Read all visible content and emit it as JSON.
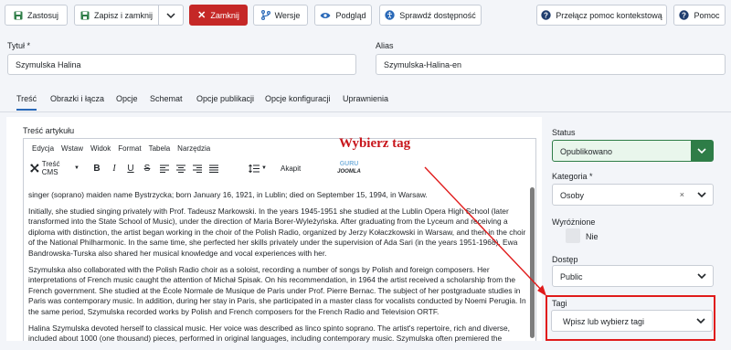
{
  "toolbar": {
    "apply": "Zastosuj",
    "save_close": "Zapisz i zamknij",
    "close": "Zamknij",
    "versions": "Wersje",
    "preview": "Podgląd",
    "accessibility": "Sprawdź dostępność",
    "toggle_help": "Przełącz pomoc kontekstową",
    "help": "Pomoc"
  },
  "form": {
    "title_label": "Tytuł *",
    "title_value": "Szymulska Halina",
    "alias_label": "Alias",
    "alias_value": "Szymulska-Halina-en"
  },
  "tabs": [
    "Treść",
    "Obrazki i łącza",
    "Opcje",
    "Schemat",
    "Opcje publikacji",
    "Opcje konfiguracji",
    "Uprawnienia"
  ],
  "editor": {
    "label": "Treść artykułu",
    "menus": [
      "Edycja",
      "Wstaw",
      "Widok",
      "Format",
      "Tabela",
      "Narzędzia"
    ],
    "cms_label": "Treść CMS",
    "font_label": "Akapit",
    "logo_top": "GURU",
    "logo_bottom": "JOOMLA",
    "paragraphs": [
      "singer (soprano) maiden name Bystrzycka; born January 16, 1921, in Lublin; died on September 15, 1994, in Warsaw.",
      "Initially, she studied singing privately with Prof. Tadeusz Markowski. In the years 1945-1951 she studied at the Lublin Opera High School (later transformed into the State School of Music), under the direction of Maria Borer-Wyleżyńska. After graduating from the Lyceum and receiving a diploma with distinction, the artist began working in the choir of the Polish Radio, organized by Jerzy Kołaczkowski in Warsaw, and then in the choir of the National Philharmonic. In the same time, she perfected her skills privately under the supervision of Ada Sari (in the years 1951-1968). Ewa Bandrowska-Turska also shared her musical knowledge and vocal experiences with her.",
      "Szymulska also collaborated with the Polish Radio choir as a soloist, recording a number of songs by Polish and foreign composers. Her interpretations of French music caught the attention of Michał Spisak. On his recommendation, in 1964 the artist received a scholarship from the French government. She studied at the École Normale de Musique de Paris under Prof. Pierre Bernac. The subject of her postgraduate studies in Paris was contemporary music. In addition, during her stay in Paris, she participated in a master class for vocalists conducted by Noemi Perugia. In the same period, Szymulska recorded works by Polish and French composers for the French Radio and Television ORTF.",
      "Halina Szymulska devoted herself to classical music. Her voice was described as linco spinto soprano. The artist's repertoire, rich and diverse, included about 1000 (one thousand) pieces, performed in original languages, including contemporary music. Szymulska often premiered the"
    ]
  },
  "sidebar": {
    "status_label": "Status",
    "status_value": "Opublikowano",
    "category_label": "Kategoria *",
    "category_value": "Osoby",
    "featured_label": "Wyróżnione",
    "featured_value": "Nie",
    "access_label": "Dostęp",
    "access_value": "Public",
    "tags_label": "Tagi",
    "tags_placeholder": "Wpisz lub wybierz tagi"
  },
  "annotation": "Wybierz tag",
  "colors": {
    "accent": "#2a69b8",
    "close_red": "#c52827",
    "status_green": "#2e7d47",
    "annotation_red": "#e01b1b"
  }
}
